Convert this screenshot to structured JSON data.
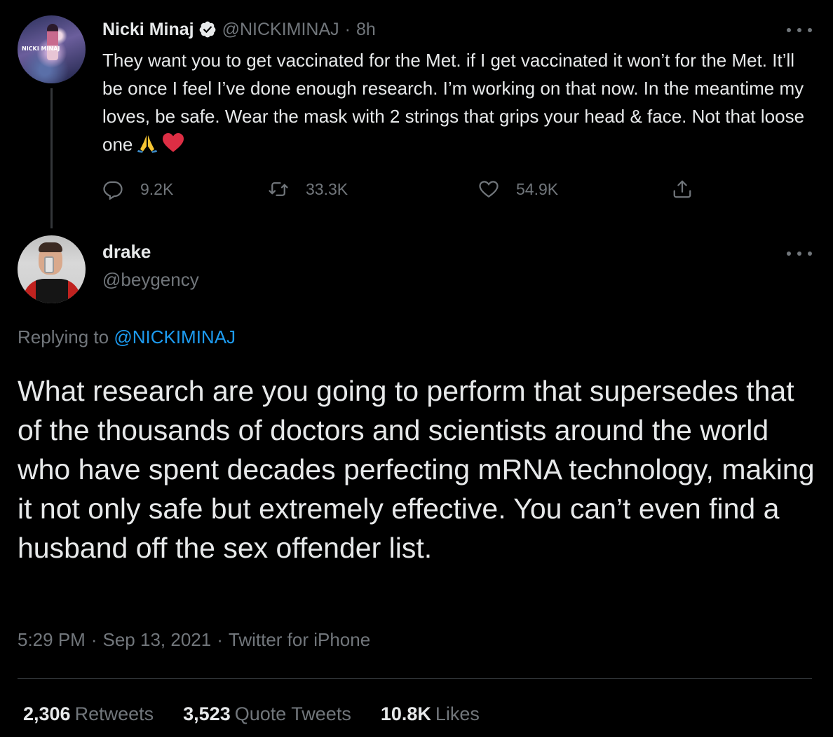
{
  "parent_tweet": {
    "author_name": "Nicki Minaj",
    "handle": "@NICKIMINAJ",
    "separator": "·",
    "time": "8h",
    "avatar_text": "NICKI MINAJ",
    "text_main": "They want you to get vaccinated for the Met. if I get vaccinated it won’t for the Met. It’ll be once I feel I’ve done enough research. I’m working on that now. In the meantime my loves, be safe. Wear the mask with 2 strings that grips your head & face. Not that loose one",
    "reply_count": "9.2K",
    "retweet_count": "33.3K",
    "like_count": "54.9K",
    "verified": true
  },
  "main_tweet": {
    "author_name": "drake",
    "handle": "@beygency",
    "replying_prefix": "Replying to",
    "replying_to": "@NICKIMINAJ",
    "text": "What research are you going to perform that supersedes that of the thousands of doctors and scientists around the world who have spent decades perfecting mRNA technology, making it not only safe but extremely effective. You can’t even find a husband off the sex offender list.",
    "time": "5:29 PM",
    "date": "Sep 13, 2021",
    "source": "Twitter for iPhone",
    "separator": "·",
    "stats": {
      "retweets_num": "2,306",
      "retweets_label": "Retweets",
      "quotes_num": "3,523",
      "quotes_label": "Quote Tweets",
      "likes_num": "10.8K",
      "likes_label": "Likes"
    }
  },
  "icons": {
    "verified": "verified-badge-icon",
    "more": "more-options-icon",
    "reply": "reply-icon",
    "retweet": "retweet-icon",
    "like": "like-heart-icon",
    "share": "share-icon",
    "pray_emoji": "folded-hands-emoji",
    "heart_emoji": "red-heart-emoji"
  },
  "colors": {
    "background": "#000000",
    "text": "#e7e9ea",
    "secondary": "#71767b",
    "link": "#1d9bf0",
    "divider": "#2f3336",
    "heart": "#e0245e"
  }
}
